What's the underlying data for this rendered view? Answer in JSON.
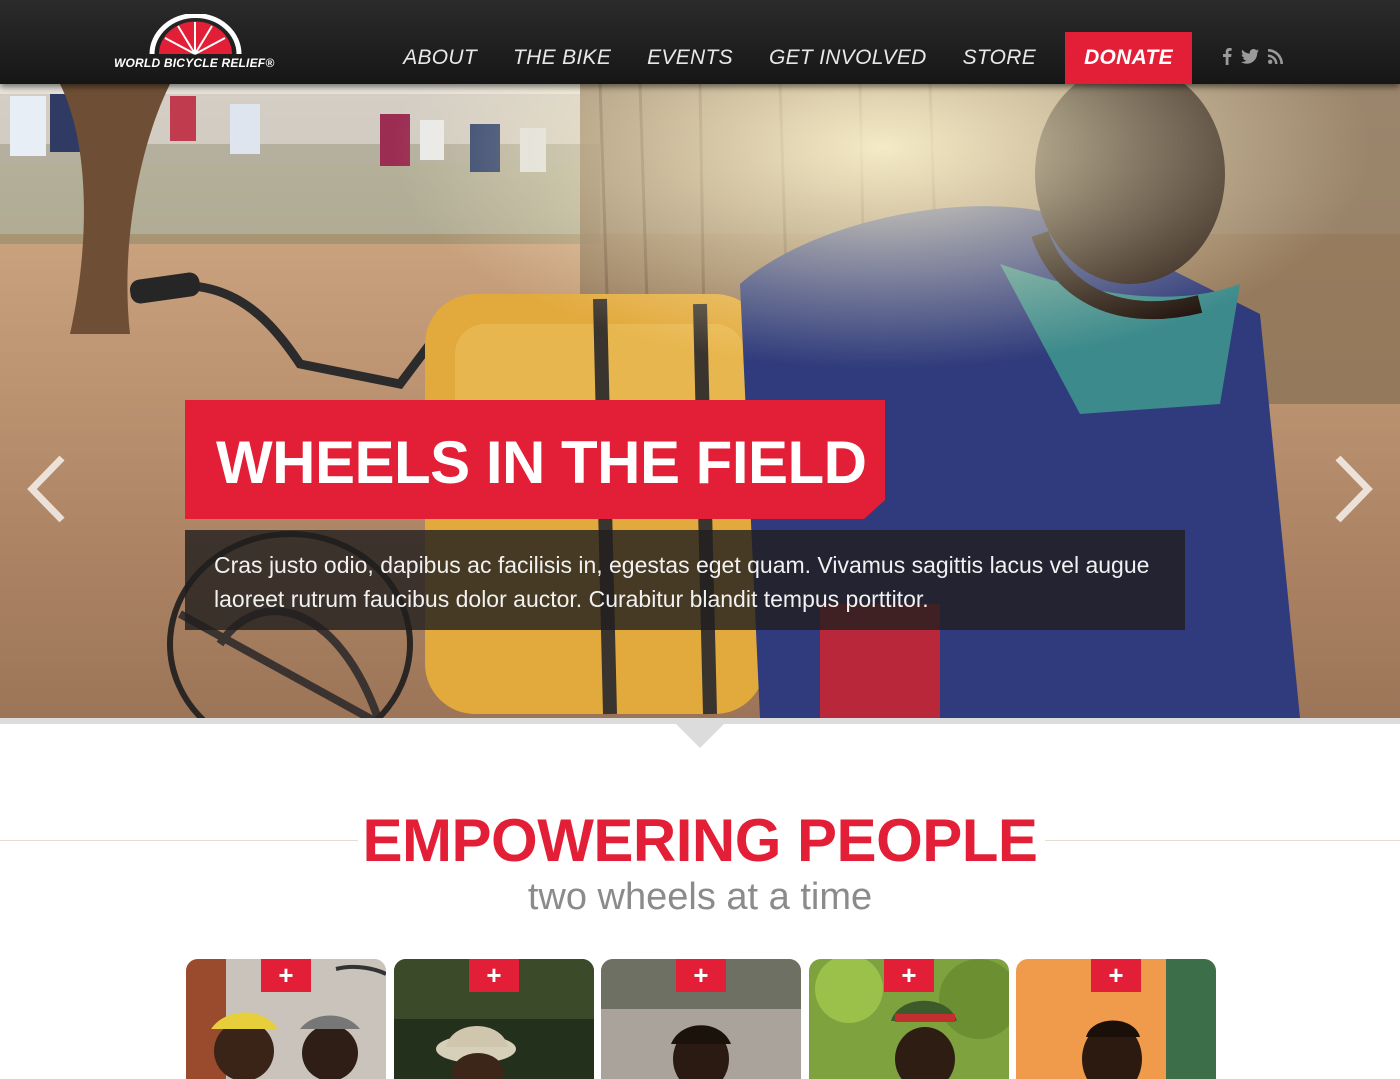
{
  "brand": {
    "logo_text": "WORLD BICYCLE RELIEF®",
    "accent": "#e21f37"
  },
  "nav": {
    "items": [
      "ABOUT",
      "THE BIKE",
      "EVENTS",
      "GET INVOLVED",
      "STORE"
    ],
    "donate": "DONATE"
  },
  "social": {
    "icons": [
      "facebook-icon",
      "twitter-icon",
      "rss-icon"
    ]
  },
  "hero": {
    "title": "WHEELS IN THE FIELD",
    "body": "Cras justo odio, dapibus ac facilisis in, egestas eget quam. Vivamus sagittis lacus vel augue laoreet rutrum faucibus dolor auctor. Curabitur blandit tempus porttitor.",
    "slides": 3,
    "active_slide": 2
  },
  "section": {
    "headline": "EMPOWERING PEOPLE",
    "subhead": "two wheels at a time"
  },
  "cards": [
    {
      "badge": "+"
    },
    {
      "badge": "+"
    },
    {
      "badge": "+"
    },
    {
      "badge": "+"
    },
    {
      "badge": "+"
    }
  ]
}
